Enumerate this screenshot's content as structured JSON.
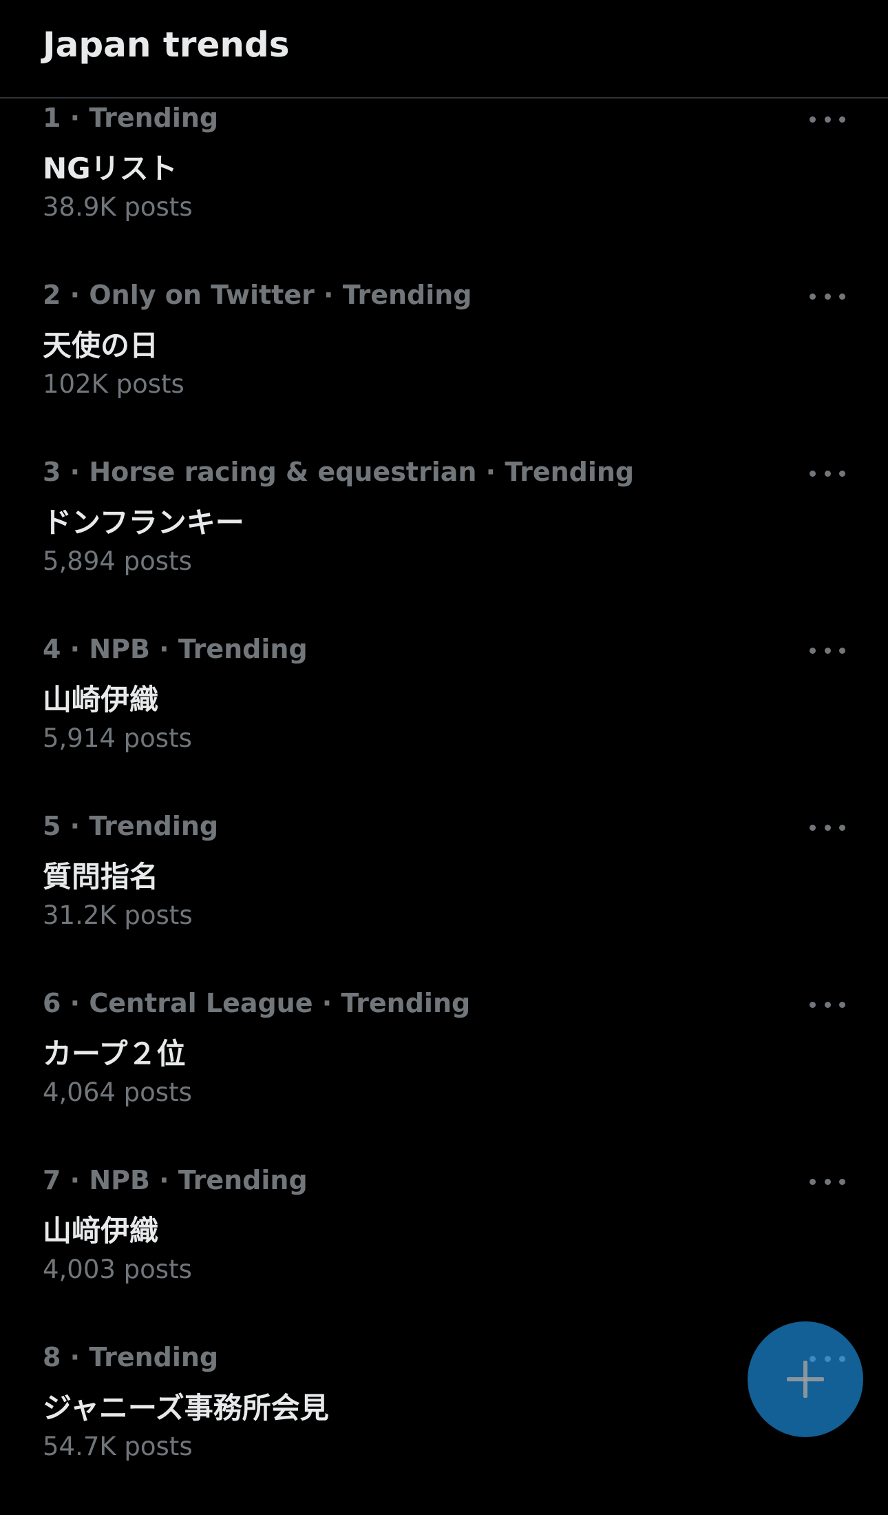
{
  "header": {
    "title": "Japan trends"
  },
  "trends": [
    {
      "meta": "1 · Trending",
      "name": "NGリスト",
      "posts": "38.9K posts"
    },
    {
      "meta": "2 · Only on Twitter · Trending",
      "name": "天使の日",
      "posts": "102K posts"
    },
    {
      "meta": "3 · Horse racing & equestrian · Trending",
      "name": "ドンフランキー",
      "posts": "5,894 posts"
    },
    {
      "meta": "4 · NPB · Trending",
      "name": "山崎伊織",
      "posts": "5,914 posts"
    },
    {
      "meta": "5 · Trending",
      "name": "質問指名",
      "posts": "31.2K posts"
    },
    {
      "meta": "6 · Central League · Trending",
      "name": "カープ２位",
      "posts": "4,064 posts"
    },
    {
      "meta": "7 · NPB · Trending",
      "name": "山﨑伊織",
      "posts": "4,003 posts"
    },
    {
      "meta": "8 · Trending",
      "name": "ジャニーズ事務所会見",
      "posts": "54.7K posts"
    }
  ],
  "icons": {
    "more": "more-horizontal-icon",
    "compose": "plus-icon"
  },
  "colors": {
    "background": "#000000",
    "primary_text": "#e7e9ea",
    "secondary_text": "#71767b",
    "divider": "#2f3336",
    "accent": "#1d9bf0"
  }
}
